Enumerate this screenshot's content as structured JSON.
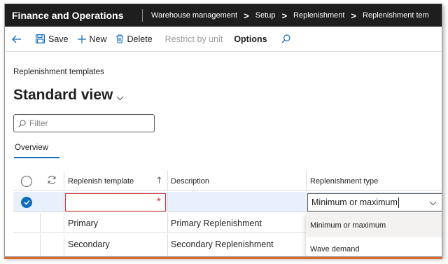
{
  "app": {
    "name": "Finance and Operations"
  },
  "breadcrumb": [
    "Warehouse management",
    "Setup",
    "Replenishment",
    "Replenishment tem"
  ],
  "toolbar": {
    "save_label": "Save",
    "new_label": "New",
    "delete_label": "Delete",
    "restrict_label": "Restrict by unit",
    "options_label": "Options"
  },
  "page": {
    "caption": "Replenishment templates",
    "title": "Standard view"
  },
  "filter": {
    "placeholder": "Filter"
  },
  "tabs": [
    {
      "label": "Overview"
    }
  ],
  "grid": {
    "columns": {
      "template": "Replenish template",
      "description": "Description",
      "type": "Replenishment type"
    },
    "rows": [
      {
        "template": "",
        "description": "",
        "type": "Minimum or maximum",
        "selected": true
      },
      {
        "template": "Primary",
        "description": "Primary Replenishment",
        "type": ""
      },
      {
        "template": "Secondary",
        "description": "Secondary Replenishment",
        "type": ""
      }
    ]
  },
  "dropdown": {
    "options": [
      "Minimum or maximum",
      "Wave demand"
    ],
    "selected": "Minimum or maximum"
  },
  "colors": {
    "accent": "#0f6cbd",
    "topbar": "#1e1e1e",
    "required": "#d13438",
    "bottom_accent": "#d96a2b"
  },
  "icons": [
    "back-arrow-icon",
    "save-icon",
    "plus-icon",
    "trash-icon",
    "search-icon",
    "chevron-down-icon",
    "refresh-icon",
    "sort-up-arrow-icon",
    "checkmark-icon",
    "filter-search-icon"
  ]
}
